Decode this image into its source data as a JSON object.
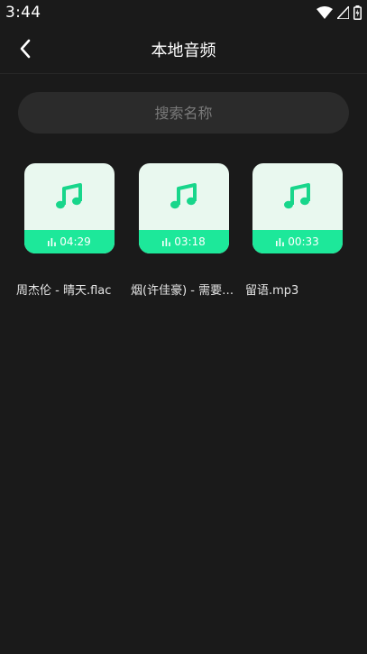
{
  "status_bar": {
    "time": "3:44",
    "icons": [
      "wifi-icon",
      "cell-signal-icon",
      "battery-icon"
    ]
  },
  "app_bar": {
    "back_icon": "chevron-left-icon",
    "title": "本地音频"
  },
  "search": {
    "placeholder": "搜索名称",
    "value": ""
  },
  "colors": {
    "background": "#1a1a1a",
    "accent": "#1de89a",
    "tile_background": "#e9f8ef",
    "note": "#18d68b"
  },
  "audio_files": [
    {
      "name": "周杰伦 - 晴天.flac",
      "duration": "04:29",
      "icon": "music-note-icon"
    },
    {
      "name": "烟(许佳豪) - 需要…",
      "duration": "03:18",
      "icon": "music-note-icon"
    },
    {
      "name": "留语.mp3",
      "duration": "00:33",
      "icon": "music-note-icon"
    }
  ]
}
